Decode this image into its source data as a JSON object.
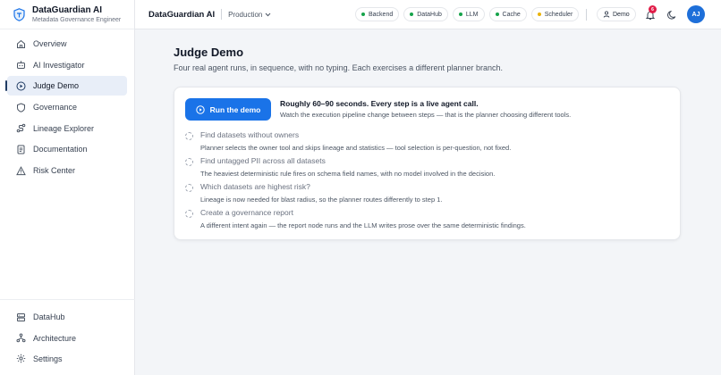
{
  "brand": {
    "name": "DataGuardian AI",
    "subtitle": "Metadata Governance Engineer"
  },
  "sidebar": {
    "items": [
      {
        "label": "Overview",
        "icon": "home-icon"
      },
      {
        "label": "AI Investigator",
        "icon": "robot-icon"
      },
      {
        "label": "Judge Demo",
        "icon": "play-circle-icon",
        "active": true
      },
      {
        "label": "Governance",
        "icon": "shield-icon"
      },
      {
        "label": "Lineage Explorer",
        "icon": "route-icon"
      },
      {
        "label": "Documentation",
        "icon": "document-icon"
      },
      {
        "label": "Risk Center",
        "icon": "warning-icon"
      }
    ],
    "bottom_items": [
      {
        "label": "DataHub",
        "icon": "database-icon"
      },
      {
        "label": "Architecture",
        "icon": "network-icon"
      },
      {
        "label": "Settings",
        "icon": "gear-icon"
      }
    ]
  },
  "topbar": {
    "app": "DataGuardian AI",
    "environment": "Production",
    "status_pills": [
      {
        "label": "Backend",
        "color": "#16a34a"
      },
      {
        "label": "DataHub",
        "color": "#16a34a"
      },
      {
        "label": "LLM",
        "color": "#16a34a"
      },
      {
        "label": "Cache",
        "color": "#16a34a"
      },
      {
        "label": "Scheduler",
        "color": "#eab308"
      }
    ],
    "demo_label": "Demo",
    "notification_count": "6",
    "avatar_initials": "AJ"
  },
  "page": {
    "title": "Judge Demo",
    "subtitle": "Four real agent runs, in sequence, with no typing. Each exercises a different planner branch."
  },
  "card": {
    "run_button": "Run the demo",
    "heading": "Roughly 60–90 seconds. Every step is a live agent call.",
    "description": "Watch the execution pipeline change between steps — that is the planner choosing different tools.",
    "steps": [
      {
        "title": "Find datasets without owners",
        "desc": "Planner selects the owner tool and skips lineage and statistics — tool selection is per-question, not fixed."
      },
      {
        "title": "Find untagged PII across all datasets",
        "desc": "The heaviest deterministic rule fires on schema field names, with no model involved in the decision."
      },
      {
        "title": "Which datasets are highest risk?",
        "desc": "Lineage is now needed for blast radius, so the planner routes differently to step 1."
      },
      {
        "title": "Create a governance report",
        "desc": "A different intent again — the report node runs and the LLM writes prose over the same deterministic findings."
      }
    ]
  },
  "colors": {
    "accent": "#1a73e8",
    "active_bg": "#e8eef8",
    "ok": "#16a34a",
    "warn": "#eab308",
    "badge": "#e11d48"
  }
}
